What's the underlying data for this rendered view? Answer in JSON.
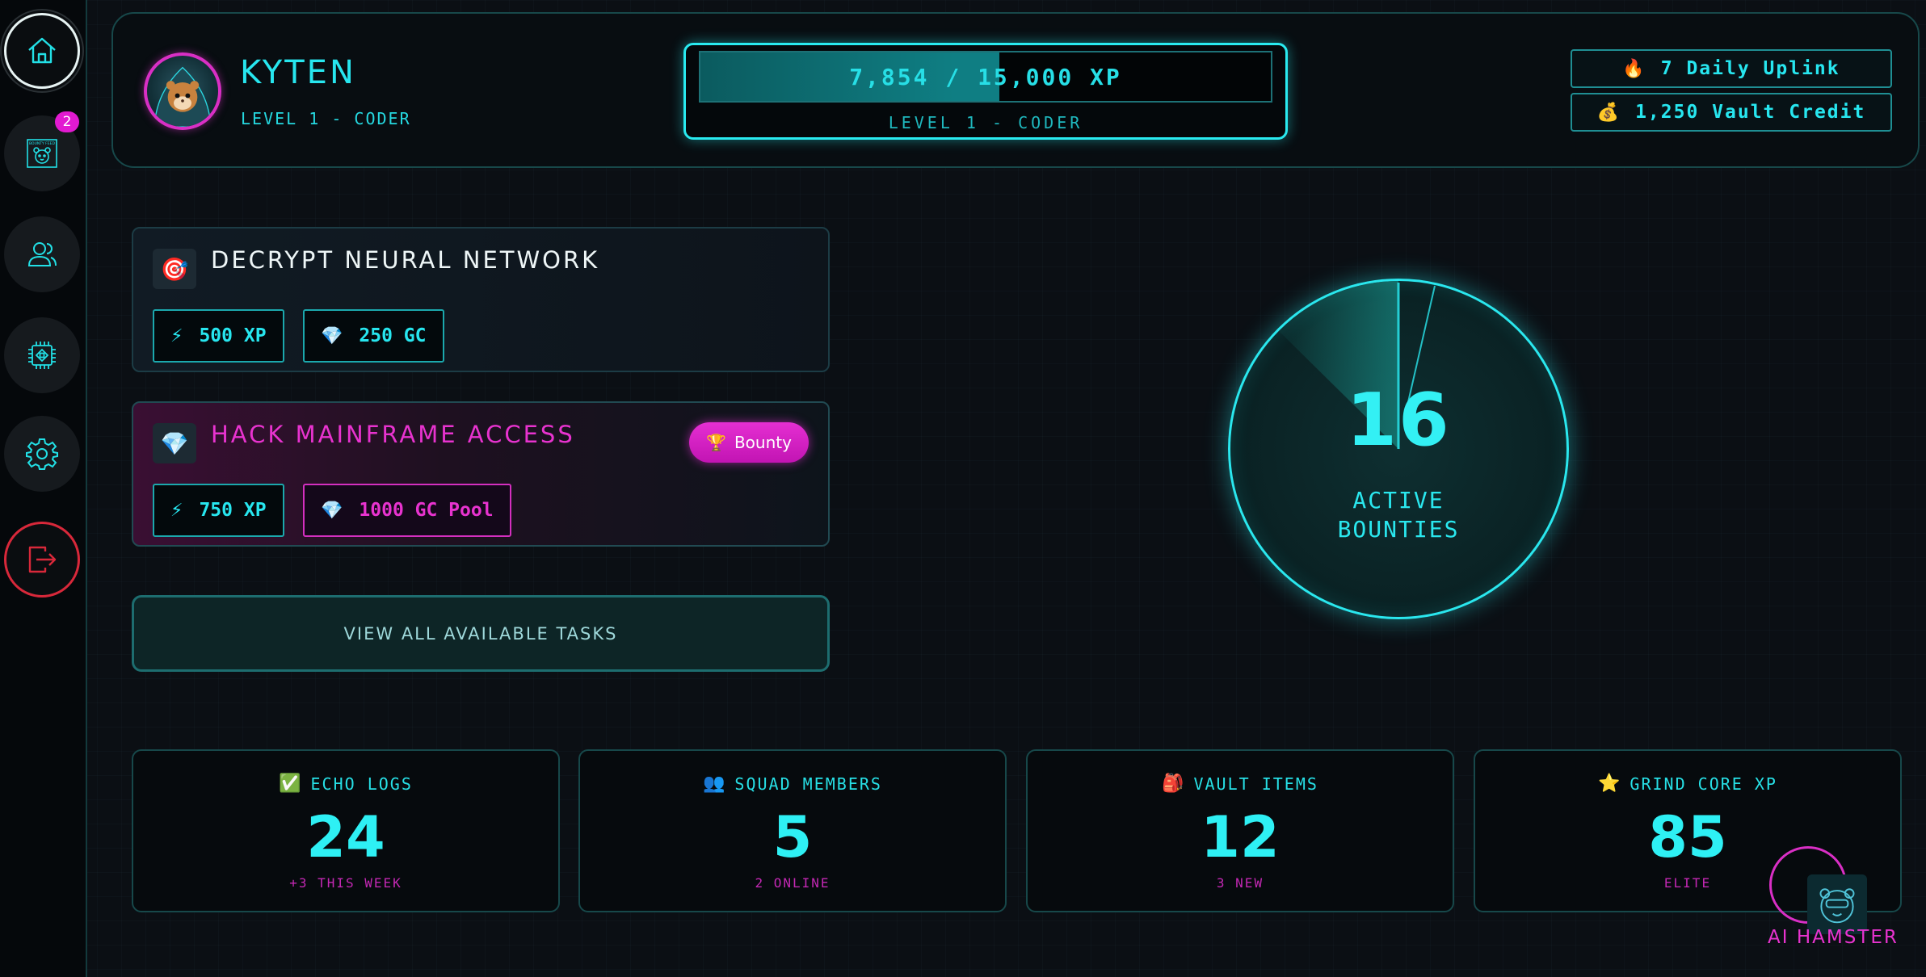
{
  "sidebar": {
    "items": [
      {
        "name": "home",
        "icon": "home-icon"
      },
      {
        "name": "bounty-feed",
        "icon": "bounty-feed-icon",
        "icon_text": "BOUNTY FEED",
        "badge": "2"
      },
      {
        "name": "users",
        "icon": "users-icon"
      },
      {
        "name": "chip",
        "icon": "chip-icon"
      },
      {
        "name": "settings",
        "icon": "gear-icon"
      },
      {
        "name": "logout",
        "icon": "logout-icon"
      }
    ]
  },
  "header": {
    "user_name": "KYTEN",
    "user_level": "LEVEL 1 - CODER",
    "xp_text": "7,854 / 15,000 XP",
    "xp_current": 7854,
    "xp_max": 15000,
    "xp_level": "LEVEL 1 - CODER",
    "daily_uplink": {
      "icon": "flame-icon",
      "glyph": "🔥",
      "label": "7 Daily Uplink"
    },
    "vault_credit": {
      "icon": "money-bag-icon",
      "glyph": "💰",
      "label": "1,250 Vault Credit"
    }
  },
  "tasks": [
    {
      "icon": "target-icon",
      "glyph": "🎯",
      "title": "DECRYPT NEURAL NETWORK",
      "rewards": [
        {
          "icon": "lightning-icon",
          "glyph": "⚡",
          "label": "500 XP"
        },
        {
          "icon": "gem-icon",
          "glyph": "💎",
          "label": "250 GC"
        }
      ]
    },
    {
      "icon": "gem-icon",
      "glyph": "💎",
      "title": "HACK MAINFRAME ACCESS",
      "tag": {
        "icon": "trophy-icon",
        "glyph": "🏆",
        "label": "Bounty"
      },
      "rewards": [
        {
          "icon": "lightning-icon",
          "glyph": "⚡",
          "label": "750 XP"
        },
        {
          "icon": "gem-icon",
          "glyph": "💎",
          "label": "1000 GC Pool"
        }
      ]
    }
  ],
  "view_all_label": "VIEW ALL AVAILABLE TASKS",
  "radar": {
    "count": "16",
    "label_line1": "ACTIVE",
    "label_line2": "BOUNTIES"
  },
  "stats": [
    {
      "icon": "check-icon",
      "glyph": "✅",
      "label": "ECHO LOGS",
      "value": "24",
      "sub": "+3 THIS WEEK"
    },
    {
      "icon": "squad-icon",
      "glyph": "👥",
      "label": "SQUAD MEMBERS",
      "value": "5",
      "sub": "2 ONLINE"
    },
    {
      "icon": "vault-icon",
      "glyph": "🎒",
      "label": "VAULT ITEMS",
      "value": "12",
      "sub": "3 NEW"
    },
    {
      "icon": "star-icon",
      "glyph": "⭐",
      "label": "GRIND CORE XP",
      "value": "85",
      "sub": "ELITE"
    }
  ],
  "ai_assistant": {
    "label": "AI HAMSTER",
    "icon": "hamster-icon"
  },
  "colors": {
    "accent": "#27e6ef",
    "pink": "#e833cf",
    "danger": "#d8283a",
    "background": "#0b0f14"
  }
}
